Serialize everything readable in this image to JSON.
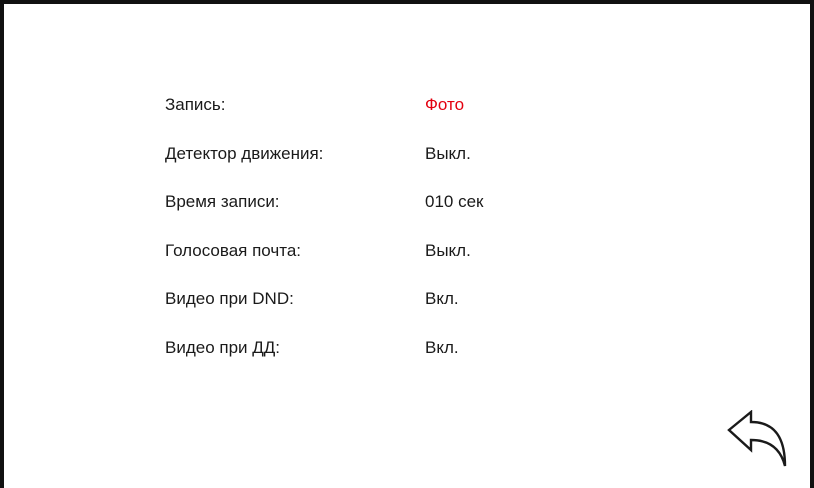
{
  "settings": {
    "items": [
      {
        "label": "Запись:",
        "value": "Фото",
        "highlighted": true
      },
      {
        "label": "Детектор движения:",
        "value": "Выкл.",
        "highlighted": false
      },
      {
        "label": "Время записи:",
        "value": "010 сек",
        "highlighted": false
      },
      {
        "label": "Голосовая почта:",
        "value": "Выкл.",
        "highlighted": false
      },
      {
        "label": "Видео при DND:",
        "value": "Вкл.",
        "highlighted": false
      },
      {
        "label": "Видео при ДД:",
        "value": "Вкл.",
        "highlighted": false
      }
    ]
  },
  "back_button": {
    "icon": "back-arrow-icon"
  },
  "colors": {
    "highlight": "#e3000f",
    "text": "#1a1a1a",
    "frame": "#111111"
  }
}
